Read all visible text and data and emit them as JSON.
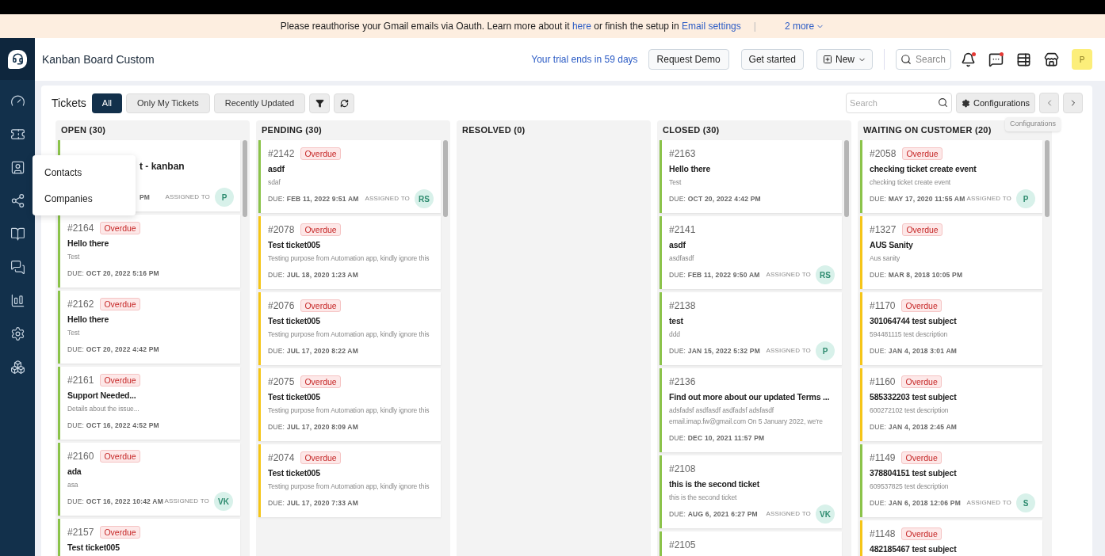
{
  "banner": {
    "message": "Please reauthorise your Gmail emails via Oauth. Learn more about it",
    "link": "here",
    "middle": "or finish the setup in",
    "settings_link": "Email settings",
    "separator": "|",
    "more": "2 more"
  },
  "sidebar": {
    "flyout": [
      "Contacts",
      "Companies"
    ]
  },
  "header": {
    "title": "Kanban Board Custom",
    "trial": "Your trial ends in 59 days",
    "buttons": [
      "Request Demo",
      "Get started"
    ],
    "new_button": "New",
    "search": {
      "placeholder": "Search"
    },
    "avatar": "P"
  },
  "board": {
    "title": "Tickets",
    "filters": [
      {
        "label": "All",
        "selected": true
      },
      {
        "label": "Only My Tickets",
        "selected": false
      },
      {
        "label": "Recently Updated",
        "selected": false
      }
    ],
    "search": {
      "placeholder": "Search"
    },
    "configurations": "Configurations",
    "tooltip": "Configurations",
    "columns": [
      {
        "title": "OPEN (30)",
        "cards": [
          {
            "kind": "covered",
            "title": "t - kanban",
            "due": "PM",
            "color": "#8bc34a",
            "assigned": {
              "label": "ASSIGNED TO",
              "initials": "P"
            }
          },
          {
            "kind": "ticket",
            "id": "#2164",
            "badge": "Overdue",
            "title": "Hello there",
            "description": "Test",
            "due": "DUE: **OCT 20, 2022 5:16 PM**",
            "color": "#8bc34a"
          },
          {
            "kind": "ticket",
            "id": "#2162",
            "badge": "Overdue",
            "title": "Hello there",
            "description": "Test",
            "due": "DUE: **OCT 20, 2022 4:42 PM**",
            "color": "#8bc34a"
          },
          {
            "kind": "ticket",
            "id": "#2161",
            "badge": "Overdue",
            "title": "Support Needed...",
            "description": "Details about the issue...",
            "due": "DUE: **OCT 16, 2022 4:52 PM**",
            "color": "#8bc34a"
          },
          {
            "kind": "ticket",
            "id": "#2160",
            "badge": "Overdue",
            "title": "ada",
            "description": "asa",
            "due": "DUE: **OCT 16, 2022 10:42 AM**",
            "color": "#8bc34a",
            "assigned": {
              "label": "ASSIGNED TO",
              "initials": "VK"
            }
          },
          {
            "kind": "ticket",
            "id": "#2157",
            "badge": "Overdue",
            "title": "Test ticket005",
            "color": "#8bc34a"
          }
        ]
      },
      {
        "title": "PENDING (30)",
        "cards": [
          {
            "kind": "ticket",
            "id": "#2142",
            "badge": "Overdue",
            "title": "asdf",
            "description": "sdaf",
            "due": "DUE: **FEB 11, 2022 9:51 AM**",
            "color": "#8bc34a",
            "assigned": {
              "label": "ASSIGNED TO",
              "initials": "RS"
            }
          },
          {
            "kind": "ticket",
            "id": "#2078",
            "badge": "Overdue",
            "title": "Test ticket005",
            "description": "Testing purpose from Automation app, kindly ignore this",
            "due": "DUE: **JUL 18, 2020 1:23 AM**",
            "color": "#f5c518"
          },
          {
            "kind": "ticket",
            "id": "#2076",
            "badge": "Overdue",
            "title": "Test ticket005",
            "description": "Testing purpose from Automation app, kindly ignore this",
            "due": "DUE: **JUL 17, 2020 8:22 AM**",
            "color": "#f5c518"
          },
          {
            "kind": "ticket",
            "id": "#2075",
            "badge": "Overdue",
            "title": "Test ticket005",
            "description": "Testing purpose from Automation app, kindly ignore this",
            "due": "DUE: **JUL 17, 2020 8:09 AM**",
            "color": "#f5c518"
          },
          {
            "kind": "ticket",
            "id": "#2074",
            "badge": "Overdue",
            "title": "Test ticket005",
            "description": "Testing purpose from Automation app, kindly ignore this",
            "due": "DUE: **JUL 17, 2020 7:33 AM**",
            "color": "#f5c518"
          }
        ]
      },
      {
        "title": "RESOLVED (0)"
      },
      {
        "title": "CLOSED (30)",
        "cards": [
          {
            "kind": "ticket",
            "id": "#2163",
            "title": "Hello there",
            "description": "Test",
            "due": "DUE: **OCT 20, 2022 4:42 PM**",
            "color": "#8bc34a"
          },
          {
            "kind": "ticket",
            "id": "#2141",
            "title": "asdf",
            "description": "asdfasdf",
            "due": "DUE: **FEB 11, 2022 9:50 AM**",
            "color": "#8bc34a",
            "assigned": {
              "label": "ASSIGNED TO",
              "initials": "RS"
            }
          },
          {
            "kind": "ticket",
            "id": "#2138",
            "title": "test",
            "description": "ddd",
            "due": "DUE: **JAN 15, 2022 5:32 PM**",
            "color": "#8bc34a",
            "assigned": {
              "label": "ASSIGNED TO",
              "initials": "P"
            }
          },
          {
            "kind": "ticket",
            "id": "#2136",
            "title": "Find out more about our updated Terms ...",
            "description": "adsfadsf asdfasdf asdfadsf adsfasdf email.imap.fw@gmail.com On 5 January 2022, we're",
            "due": "DUE: **DEC 10, 2021 11:57 PM**",
            "color": "#8bc34a"
          },
          {
            "kind": "ticket",
            "id": "#2108",
            "title": "this is the second ticket",
            "description": "this is the second ticket",
            "due": "DUE: **AUG 6, 2021 6:27 PM**",
            "color": "#8bc34a",
            "assigned": {
              "label": "ASSIGNED TO",
              "initials": "VK"
            }
          },
          {
            "kind": "ticket",
            "id": "#2105",
            "color": "#8bc34a"
          }
        ]
      },
      {
        "title": "WAITING ON CUSTOMER (20)",
        "cards": [
          {
            "kind": "ticket",
            "id": "#2058",
            "badge": "Overdue",
            "title": "checking ticket create event",
            "description": "checking ticket create event",
            "due": "DUE: **MAY 17, 2020 11:55 AM**",
            "color": "#8bc34a",
            "assigned": {
              "label": "ASSIGNED TO",
              "initials": "P"
            }
          },
          {
            "kind": "ticket",
            "id": "#1327",
            "badge": "Overdue",
            "title": "AUS Sanity",
            "description": "Aus sanity",
            "due": "DUE: **MAR 8, 2018 10:05 PM**",
            "color": "#f5c518"
          },
          {
            "kind": "ticket",
            "id": "#1170",
            "badge": "Overdue",
            "title": "301064744 test subject",
            "description": "594481115 test description",
            "due": "DUE: **JAN 4, 2018 3:01 AM**",
            "color": "#f5c518"
          },
          {
            "kind": "ticket",
            "id": "#1160",
            "badge": "Overdue",
            "title": "585332203 test subject",
            "description": "600272102 test description",
            "due": "DUE: **JAN 4, 2018 2:45 AM**",
            "color": "#f5c518"
          },
          {
            "kind": "ticket",
            "id": "#1149",
            "badge": "Overdue",
            "title": "378804151 test subject",
            "description": "609537825 test description",
            "due": "DUE: **JAN 6, 2018 12:06 PM**",
            "color": "#8bc34a",
            "assigned": {
              "label": "ASSIGNED TO",
              "initials": "S"
            }
          },
          {
            "kind": "ticket",
            "id": "#1148",
            "badge": "Overdue",
            "title": "482185467 test subject",
            "color": "#f5c518"
          }
        ]
      }
    ]
  }
}
